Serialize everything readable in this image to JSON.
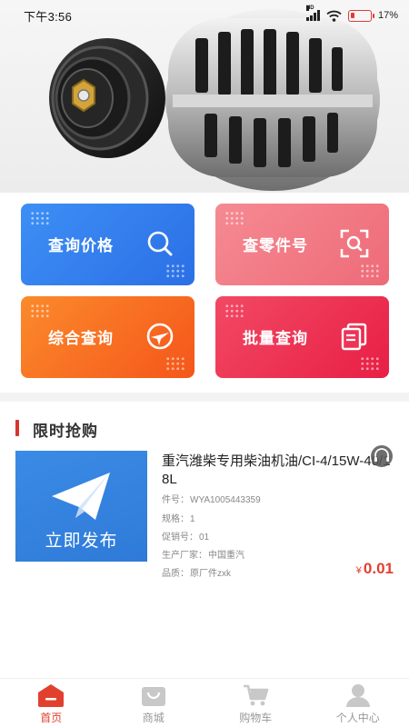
{
  "status_bar": {
    "time": "下午3:56",
    "network": "HD",
    "battery_percent": "17%"
  },
  "banner": {
    "image": "alternator-photo"
  },
  "quick_tiles": [
    {
      "label": "查询价格",
      "icon": "search-icon",
      "color": "#3a8bf2"
    },
    {
      "label": "查零件号",
      "icon": "scan-icon",
      "color": "#f07a85"
    },
    {
      "label": "综合查询",
      "icon": "plane-circle-icon",
      "color": "#f76f22"
    },
    {
      "label": "批量查询",
      "icon": "documents-icon",
      "color": "#ec2e52"
    }
  ],
  "flash_sale": {
    "title": "限时抢购",
    "product": {
      "image_label": "立即发布",
      "title": "重汽潍柴专用柴油机油/CI-4/15W-40/18L",
      "fields": [
        {
          "key": "件号：",
          "value": "WYA1005443359"
        },
        {
          "key": "规格：",
          "value": "1"
        },
        {
          "key": "促销号：",
          "value": "01"
        },
        {
          "key": "生产厂家：",
          "value": "中国重汽"
        },
        {
          "key": "品质：",
          "value": "原厂件zxk"
        }
      ],
      "currency": "¥",
      "price": "0.01"
    }
  },
  "tabbar": {
    "active_color": "#e2402f",
    "items": [
      {
        "label": "首页",
        "icon": "home-icon",
        "active": true
      },
      {
        "label": "商城",
        "icon": "shop-bag-icon",
        "active": false
      },
      {
        "label": "购物车",
        "icon": "cart-icon",
        "active": false
      },
      {
        "label": "个人中心",
        "icon": "user-icon",
        "active": false
      }
    ]
  }
}
